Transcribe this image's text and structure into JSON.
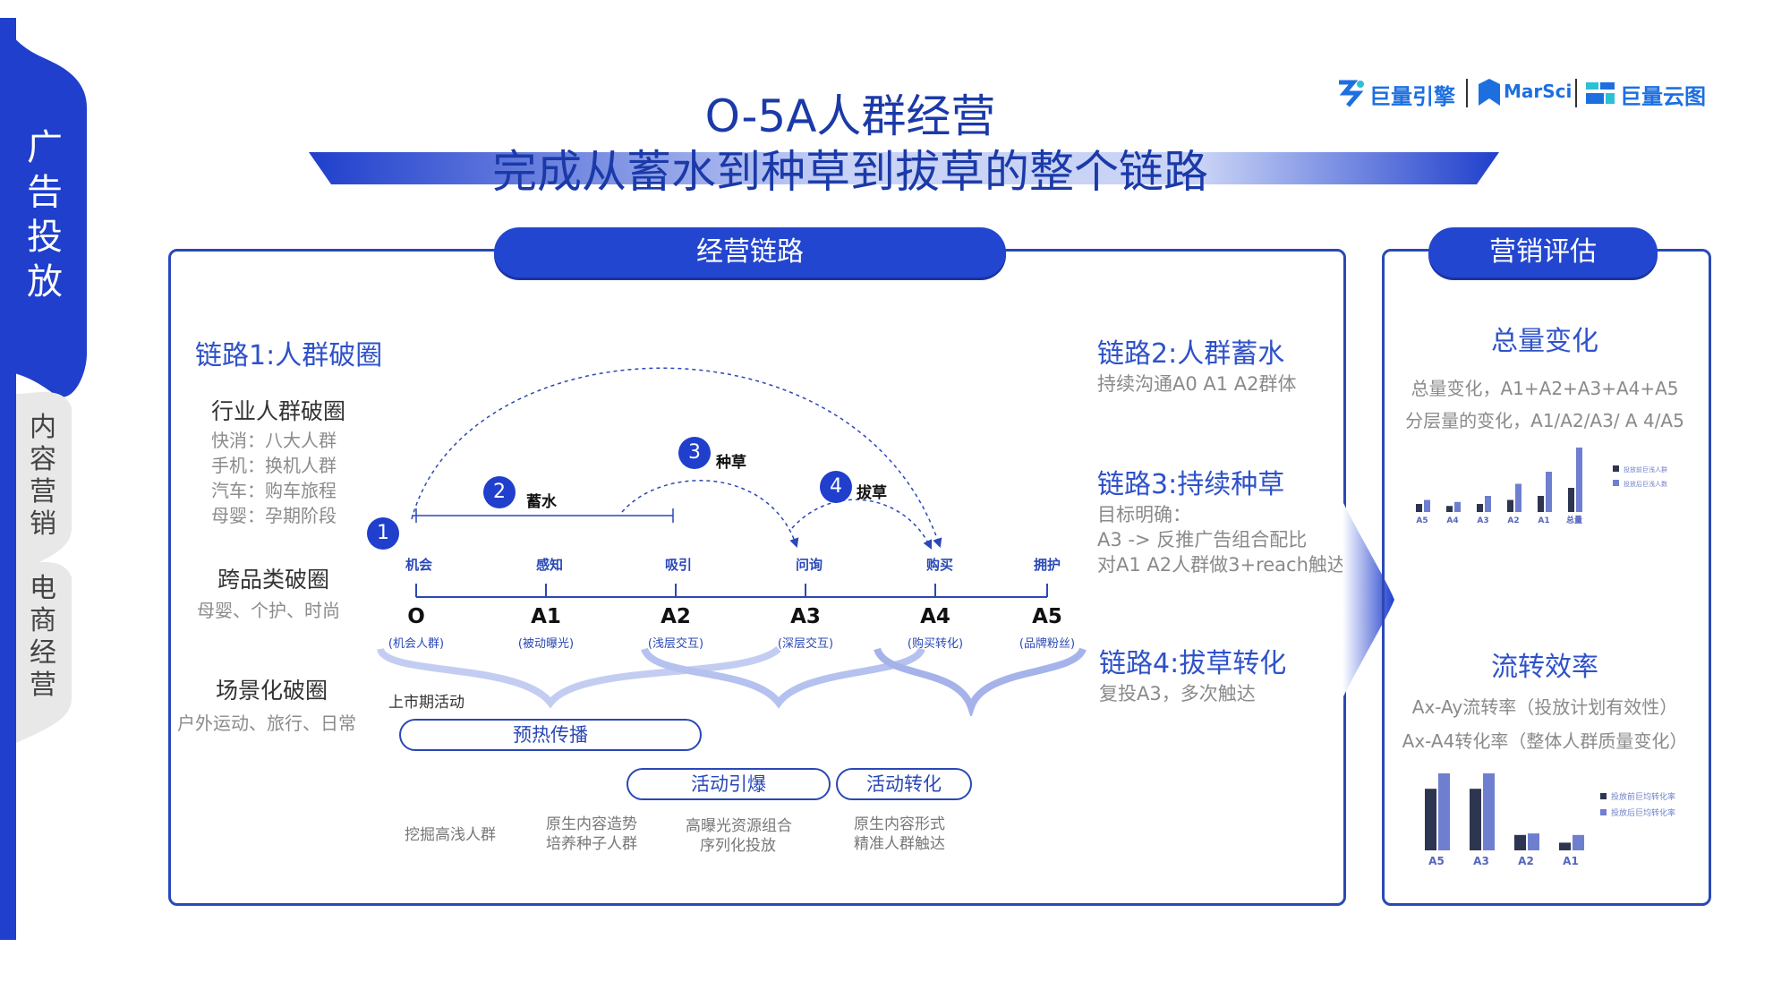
{
  "side_tabs": {
    "active": "广告投放",
    "tab2": "内容营销",
    "tab3": "电商经营"
  },
  "header": {
    "title_line1": "O-5A人群经营",
    "title_line2": "完成从蓄水到种草到拔草的整个链路",
    "logos": [
      "巨量引擎",
      "MarSci",
      "巨量云图"
    ]
  },
  "main_panel": {
    "title": "经营链路",
    "chain1": {
      "title": "链路1:人群破圈",
      "industry_title": "行业人群破圈",
      "industry_items": [
        "快消：八大人群",
        "手机：换机人群",
        "汽车：购车旅程",
        "母婴：孕期阶段"
      ],
      "cross_title": "跨品类破圈",
      "cross_desc": "母婴、个护、时尚",
      "scene_title": "场景化破圈",
      "scene_desc": "户外运动、旅行、日常"
    },
    "chain2": {
      "title": "链路2:人群蓄水",
      "desc": "持续沟通A0 A1 A2群体"
    },
    "chain3": {
      "title": "链路3:持续种草",
      "desc": [
        "目标明确：",
        "A3 -> 反推广告组合配比",
        "对A1 A2人群做3+reach触达"
      ]
    },
    "chain4": {
      "title": "链路4:拔草转化",
      "desc": "复投A3，多次触达"
    },
    "steps": [
      {
        "num": "1",
        "label": ""
      },
      {
        "num": "2",
        "label": "蓄水"
      },
      {
        "num": "3",
        "label": "种草"
      },
      {
        "num": "4",
        "label": "拔草"
      }
    ],
    "stages": [
      {
        "name": "机会",
        "code": "O",
        "sub": "(机会人群)"
      },
      {
        "name": "感知",
        "code": "A1",
        "sub": "(被动曝光)"
      },
      {
        "name": "吸引",
        "code": "A2",
        "sub": "(浅层交互)"
      },
      {
        "name": "问询",
        "code": "A3",
        "sub": "(深层交互)"
      },
      {
        "name": "购买",
        "code": "A4",
        "sub": "(购买转化)"
      },
      {
        "name": "拥护",
        "code": "A5",
        "sub": "(品牌粉丝)"
      }
    ],
    "launch_label": "上市期活动",
    "phases": [
      "预热传播",
      "活动引爆",
      "活动转化"
    ],
    "phase_notes": [
      [
        "挖掘高浅人群"
      ],
      [
        "原生内容造势",
        "培养种子人群"
      ],
      [
        "高曝光资源组合",
        "序列化投放"
      ],
      [
        "原生内容形式",
        "精准人群触达"
      ]
    ]
  },
  "eval_panel": {
    "title": "营销评估",
    "total": {
      "title": "总量变化",
      "lines": [
        "总量变化，A1+A2+A3+A4+A5",
        "分层量的变化，A1/A2/A3/ A 4/A5"
      ]
    },
    "flow": {
      "title": "流转效率",
      "lines": [
        "Ax-Ay流转率（投放计划有效性）",
        "Ax-A4转化率（整体人群质量变化）"
      ]
    }
  },
  "chart_data": [
    {
      "type": "bar",
      "categories": [
        "A5",
        "A4",
        "A3",
        "A2",
        "A1",
        "总量"
      ],
      "series": [
        {
          "name": "投放前巨浅人群",
          "values": [
            2,
            1.5,
            2,
            3,
            4,
            6
          ]
        },
        {
          "name": "投放后巨浅人数",
          "values": [
            3,
            2.5,
            4,
            7,
            10,
            16
          ]
        }
      ],
      "colors": [
        "#2d3550",
        "#6e7fd0"
      ]
    },
    {
      "type": "bar",
      "categories": [
        "A5",
        "A3",
        "A2",
        "A1"
      ],
      "series": [
        {
          "name": "投放前巨均转化率",
          "values": [
            8,
            8,
            2,
            1
          ]
        },
        {
          "name": "投放后巨均转化率",
          "values": [
            10,
            10,
            2.2,
            2
          ]
        }
      ],
      "colors": [
        "#2d3550",
        "#6e7fd0"
      ]
    }
  ]
}
